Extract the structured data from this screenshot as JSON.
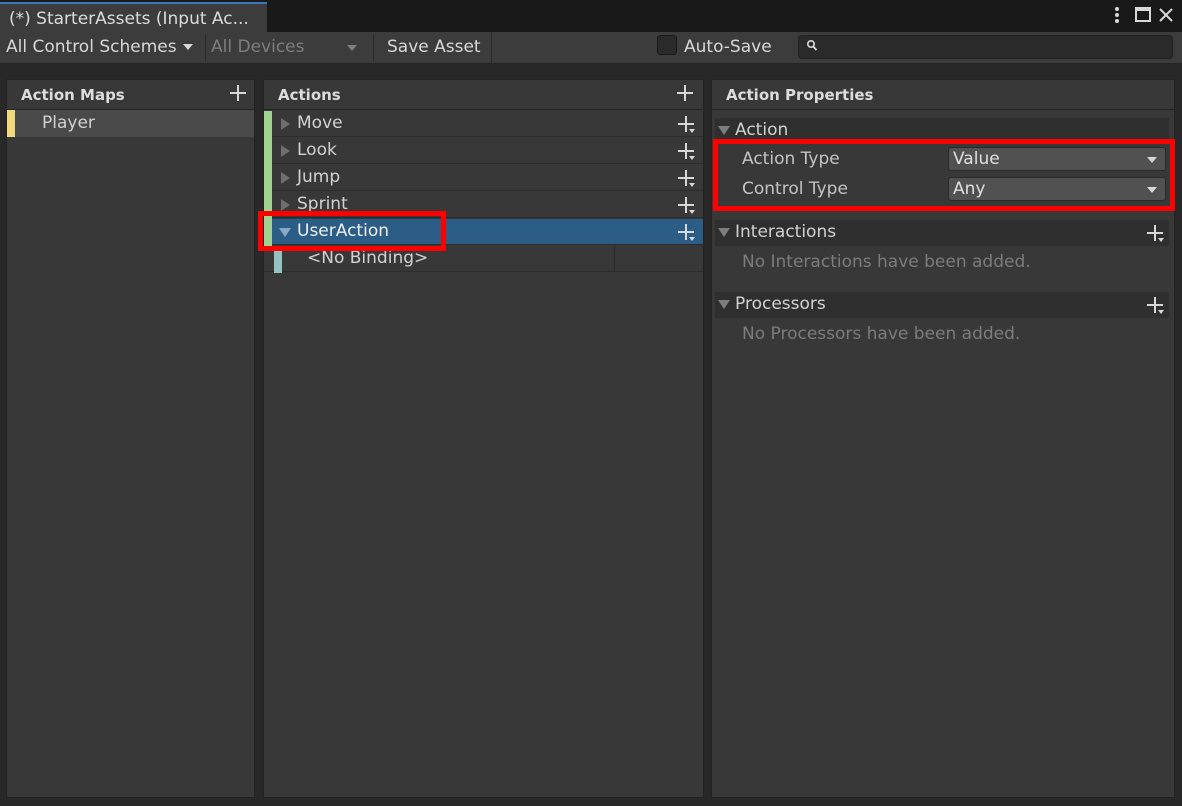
{
  "window": {
    "tab_title": "(*) StarterAssets (Input Ac...",
    "menu_icon": "kebab-menu-icon",
    "maximize_icon": "maximize-icon",
    "close_icon": "close-icon"
  },
  "toolbar": {
    "control_schemes": "All Control Schemes",
    "devices": "All Devices",
    "save_asset": "Save Asset",
    "auto_save_label": "Auto-Save",
    "auto_save_checked": false,
    "search_value": "",
    "search_icon": "search-icon"
  },
  "action_maps": {
    "title": "Action Maps",
    "items": [
      {
        "label": "Player",
        "selected": true,
        "color": "#f1da7e"
      }
    ]
  },
  "actions": {
    "title": "Actions",
    "items": [
      {
        "label": "Move",
        "expanded": false,
        "selected": false
      },
      {
        "label": "Look",
        "expanded": false,
        "selected": false
      },
      {
        "label": "Jump",
        "expanded": false,
        "selected": false
      },
      {
        "label": "Sprint",
        "expanded": false,
        "selected": false
      },
      {
        "label": "UserAction",
        "expanded": true,
        "selected": true
      }
    ],
    "binding": "<No Binding>",
    "action_color": "#a0d392",
    "binding_color": "#97c2c4",
    "selected_color": "#2c5d87"
  },
  "properties": {
    "title": "Action Properties",
    "action_section": "Action",
    "action_type_label": "Action Type",
    "action_type_value": "Value",
    "control_type_label": "Control Type",
    "control_type_value": "Any",
    "interactions_section": "Interactions",
    "interactions_empty": "No Interactions have been added.",
    "processors_section": "Processors",
    "processors_empty": "No Processors have been added."
  },
  "annotation_color": "#ff0000"
}
